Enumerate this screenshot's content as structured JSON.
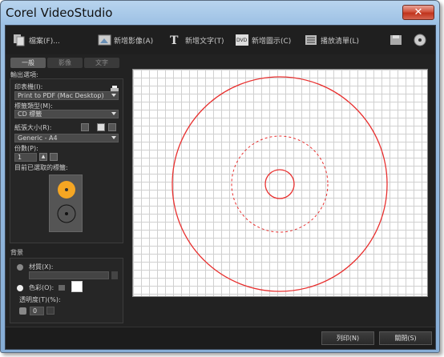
{
  "window": {
    "title": "Corel VideoStudio",
    "close_glyph": "✕"
  },
  "toolbar": {
    "file": "檔案(F)...",
    "add_image": "新增影像(A)",
    "add_text": "新增文字(T)",
    "add_shape": "新增圖示(C)",
    "playlist": "播放清單(L)"
  },
  "tabs": [
    "一般",
    "影像",
    "文字"
  ],
  "output": {
    "heading": "輸出選項:",
    "printer_label": "印表機(I):",
    "printer_value": "Print to PDF (Mac Desktop)",
    "label_type_label": "標籤類型(M):",
    "label_type_value": "CD 標籤",
    "paper_size_label": "紙張大小(R):",
    "paper_size_value": "Generic - A4",
    "copies_label": "份數(P):",
    "copies_value": "1",
    "selected_label": "目前已選取的標籤:"
  },
  "background": {
    "heading": "背景",
    "material_label": "材質(X):",
    "color_label": "色彩(O):",
    "opacity_label": "透明度(T)(%):",
    "opacity_value": "0"
  },
  "buttons": {
    "print": "列印(N)",
    "close": "關閉(S)"
  },
  "colors": {
    "disc_line": "#e8302f",
    "selected_label": "#f5a623"
  }
}
